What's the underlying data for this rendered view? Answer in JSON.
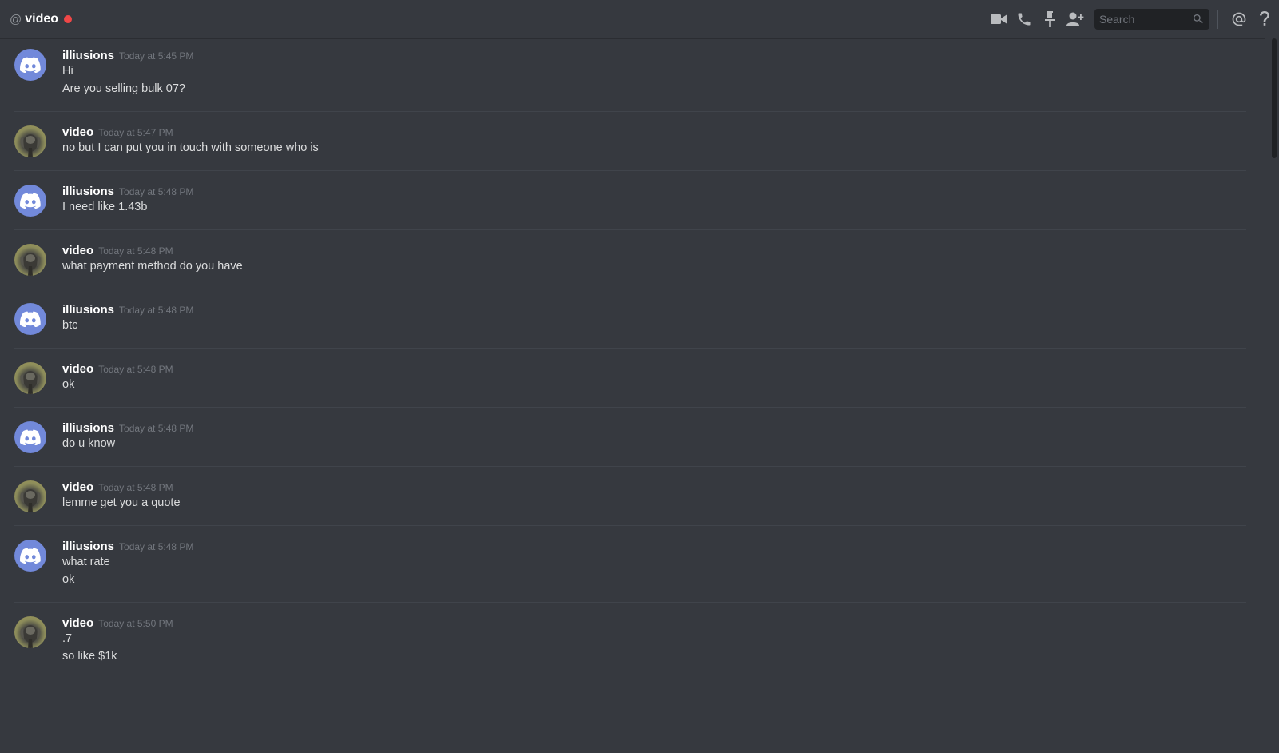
{
  "header": {
    "at": "@",
    "channel": "video",
    "status_color": "#f04747",
    "icons": [
      "video-call-icon",
      "phone-icon",
      "pin-icon",
      "add-friend-icon",
      "mention-icon",
      "help-icon"
    ],
    "search_placeholder": "Search"
  },
  "messages": [
    {
      "author": "illiusions",
      "timestamp": "Today at 5:45 PM",
      "avatar": "discord",
      "lines": [
        "Hi",
        "Are you selling bulk 07?"
      ]
    },
    {
      "author": "video",
      "timestamp": "Today at 5:47 PM",
      "avatar": "photo",
      "lines": [
        "no but I can put you in touch with someone who is"
      ]
    },
    {
      "author": "illiusions",
      "timestamp": "Today at 5:48 PM",
      "avatar": "discord",
      "lines": [
        "I need like 1.43b"
      ]
    },
    {
      "author": "video",
      "timestamp": "Today at 5:48 PM",
      "avatar": "photo",
      "lines": [
        "what payment method do you have"
      ]
    },
    {
      "author": "illiusions",
      "timestamp": "Today at 5:48 PM",
      "avatar": "discord",
      "lines": [
        "btc"
      ]
    },
    {
      "author": "video",
      "timestamp": "Today at 5:48 PM",
      "avatar": "photo",
      "lines": [
        "ok"
      ]
    },
    {
      "author": "illiusions",
      "timestamp": "Today at 5:48 PM",
      "avatar": "discord",
      "lines": [
        "do u know"
      ]
    },
    {
      "author": "video",
      "timestamp": "Today at 5:48 PM",
      "avatar": "photo",
      "lines": [
        "lemme get you a quote"
      ]
    },
    {
      "author": "illiusions",
      "timestamp": "Today at 5:48 PM",
      "avatar": "discord",
      "lines": [
        "what rate",
        "ok"
      ]
    },
    {
      "author": "video",
      "timestamp": "Today at 5:50 PM",
      "avatar": "photo",
      "lines": [
        ".7",
        "so like $1k"
      ]
    }
  ]
}
